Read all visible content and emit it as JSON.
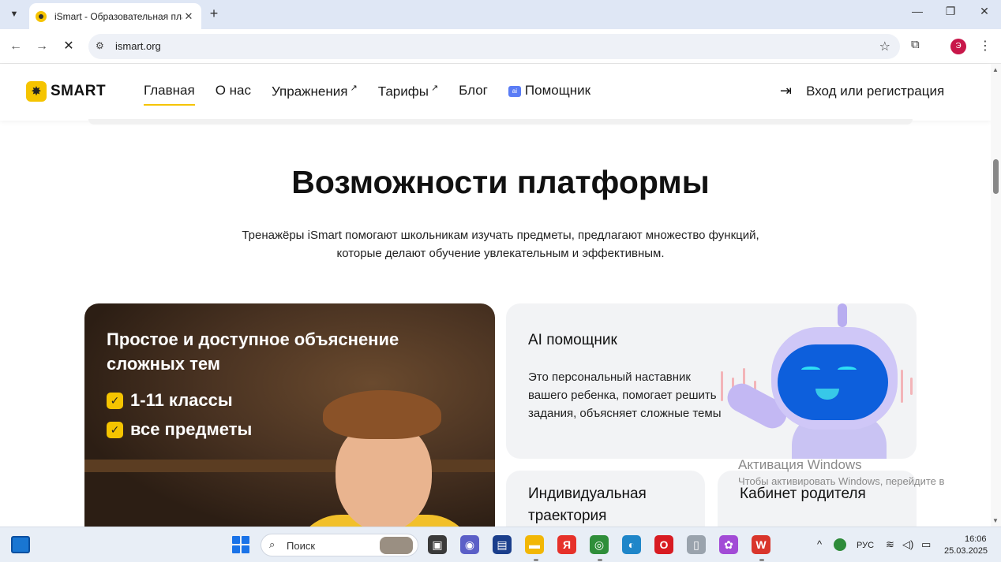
{
  "browser": {
    "tab_menu_icon": "chevron-down-icon",
    "tab_title": "iSmart - Образовательная пла",
    "tab_close": "✕",
    "new_tab": "+",
    "window_min": "—",
    "window_max": "❐",
    "window_close": "✕",
    "back": "←",
    "forward": "→",
    "stop": "✕",
    "site_info": "⚙",
    "url": "ismart.org",
    "star": "☆",
    "extensions": "⧉",
    "profile_letter": "Э",
    "menu": "⋮"
  },
  "header": {
    "logo_text": "SMART",
    "logo_mark": "✸",
    "nav": [
      {
        "label": "Главная",
        "external": false
      },
      {
        "label": "О нас",
        "external": false
      },
      {
        "label": "Упражнения",
        "external": true
      },
      {
        "label": "Тарифы",
        "external": true
      },
      {
        "label": "Блог",
        "external": false
      },
      {
        "label": "Помощник",
        "external": false
      }
    ],
    "external_arrow": "↗",
    "ai_badge": "ai",
    "login_icon": "⇥",
    "login_label": "Вход или регистрация"
  },
  "section": {
    "title": "Возможности платформы",
    "subtitle": "Тренажёры iSmart помогают школьникам изучать предметы, предлагают множество функций, которые делают обучение увлекательным и эффективным."
  },
  "cards": {
    "photo": {
      "title": "Простое и доступное объяснение сложных тем",
      "checks": [
        "1-11 классы",
        "все предметы"
      ],
      "check_mark": "✓"
    },
    "ai": {
      "title": "AI помощник",
      "description": "Это персональный наставник вашего ребенка, помогает решить задания, объясняет сложные темы"
    },
    "individual": {
      "title": "Индивидуальная траектория"
    },
    "parent": {
      "title": "Кабинет родителя"
    }
  },
  "watermark": {
    "title": "Активация Windows",
    "subtitle": "Чтобы активировать Windows, перейдите в"
  },
  "taskbar": {
    "search_icon": "⌕",
    "search_label": "Поиск",
    "apps": [
      {
        "name": "task-view",
        "glyph": "▣",
        "color": "#3a3a3a"
      },
      {
        "name": "teams",
        "glyph": "◉",
        "color": "#5b5fc7"
      },
      {
        "name": "save",
        "glyph": "▤",
        "color": "#1a3e8c"
      },
      {
        "name": "folder",
        "glyph": "▬",
        "color": "#f2b705"
      },
      {
        "name": "yandex",
        "glyph": "Я",
        "color": "#e6312a"
      },
      {
        "name": "chrome",
        "glyph": "◎",
        "color": "#2f8e3a"
      },
      {
        "name": "edge",
        "glyph": "◐",
        "color": "#1f86c9"
      },
      {
        "name": "opera",
        "glyph": "O",
        "color": "#d81b22"
      },
      {
        "name": "file",
        "glyph": "▯",
        "color": "#9aa3ad"
      },
      {
        "name": "picasa",
        "glyph": "✿",
        "color": "#a24bd6"
      },
      {
        "name": "wps",
        "glyph": "W",
        "color": "#d9352b"
      }
    ],
    "tray_chevron": "^",
    "tray_lang": "РУС",
    "tray_wifi": "≋",
    "tray_sound": "◁)",
    "tray_battery": "▭",
    "time": "16:06",
    "date": "25.03.2025"
  }
}
